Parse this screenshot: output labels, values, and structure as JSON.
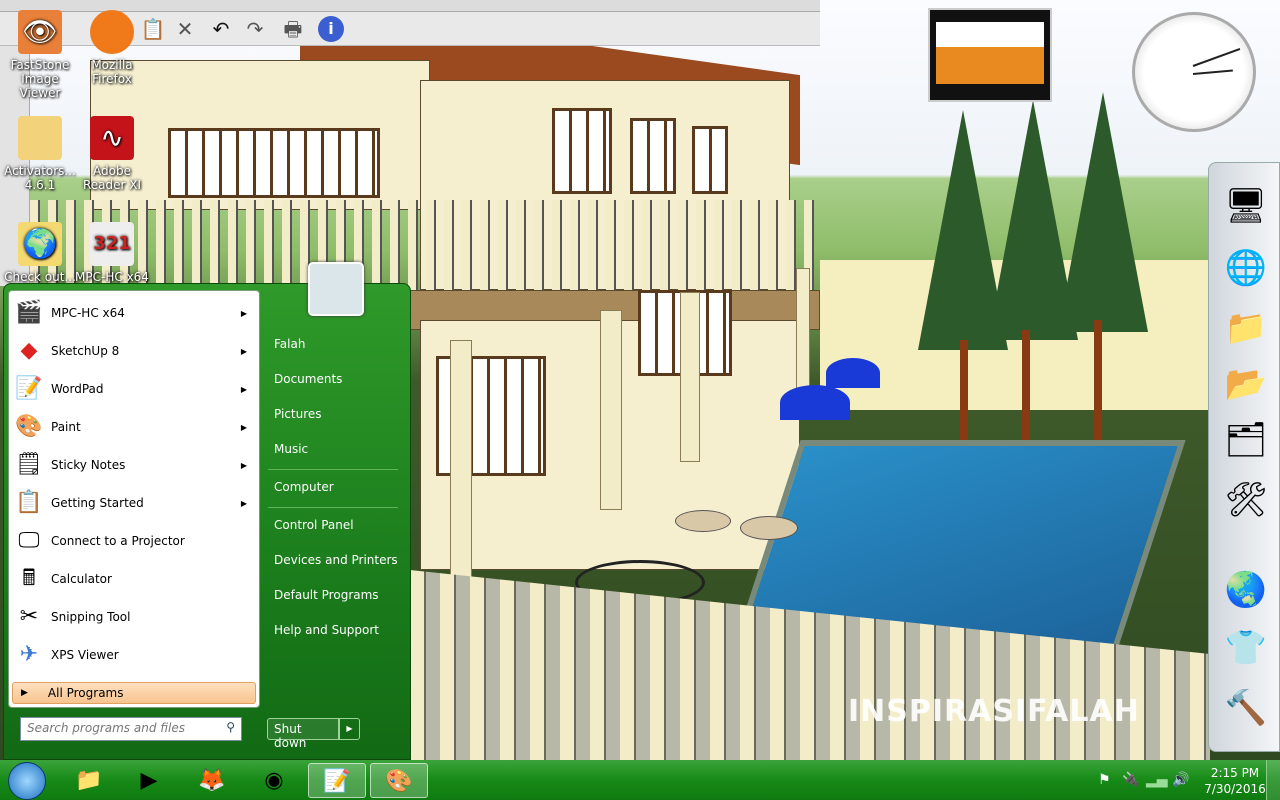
{
  "desktop_icons": [
    {
      "label": "FastStone Image Viewer",
      "icon": "eye-icon"
    },
    {
      "label": "Mozilla Firefox",
      "icon": "firefox-icon"
    },
    {
      "label": "Activators... 4.6.1",
      "icon": "folder-icon"
    },
    {
      "label": "Adobe Reader XI",
      "icon": "pdf-icon"
    },
    {
      "label": "Check out...",
      "icon": "globe-icon"
    },
    {
      "label": "MPC-HC x64",
      "icon": "clapper-icon"
    }
  ],
  "start_menu": {
    "programs": [
      {
        "label": "MPC-HC x64",
        "icon": "mpc-icon",
        "submenu": true
      },
      {
        "label": "SketchUp 8",
        "icon": "sketchup-icon",
        "submenu": true
      },
      {
        "label": "WordPad",
        "icon": "wordpad-icon",
        "submenu": true
      },
      {
        "label": "Paint",
        "icon": "paint-icon",
        "submenu": true
      },
      {
        "label": "Sticky Notes",
        "icon": "sticky-notes-icon",
        "submenu": true
      },
      {
        "label": "Getting Started",
        "icon": "getting-started-icon",
        "submenu": true
      },
      {
        "label": "Connect to a Projector",
        "icon": "projector-icon",
        "submenu": false
      },
      {
        "label": "Calculator",
        "icon": "calculator-icon",
        "submenu": false
      },
      {
        "label": "Snipping Tool",
        "icon": "scissors-icon",
        "submenu": false
      },
      {
        "label": "XPS Viewer",
        "icon": "xps-icon",
        "submenu": false
      }
    ],
    "all_programs": "All Programs",
    "search_placeholder": "Search programs and files",
    "right_items": [
      "Falah",
      "Documents",
      "Pictures",
      "Music",
      "Computer",
      "Control Panel",
      "Devices and Printers",
      "Default Programs",
      "Help and Support"
    ],
    "shutdown": "Shut down"
  },
  "tray": {
    "time": "2:15 PM",
    "date": "7/30/2016"
  },
  "watermark": "INSPIRASIFALAH",
  "colors": {
    "taskbar": "#178a17",
    "start_menu": "#1b7d1c",
    "all_programs_highlight": "#f8c48e"
  }
}
